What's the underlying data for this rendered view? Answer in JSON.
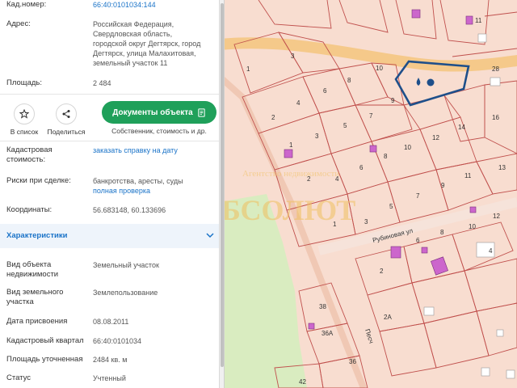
{
  "info": {
    "cad_number_label": "Кад.номер:",
    "cad_number_value": "66:40:0101034:144",
    "address_label": "Адрес:",
    "address_lines": [
      "Российская Федерация,",
      "Свердловская область,",
      "городской округ Дегтярск, город",
      "Дегтярск, улица Малахитовая,",
      "земельный участок 11"
    ],
    "area_label": "Площадь:",
    "area_value": "2 484"
  },
  "actions": {
    "favorites_label": "В список",
    "share_label": "Поделиться",
    "docs_button_label": "Документы объекта",
    "docs_sub_label": "Собственник, стоимость и др."
  },
  "details": {
    "cad_value_label_1": "Кадастровая",
    "cad_value_label_2": "стоимость:",
    "cad_value_link": "заказать справку на дату",
    "risks_label": "Риски при сделке:",
    "risks_value": "банкротства, аресты, суды",
    "risks_link": "полная проверка",
    "coords_label": "Координаты:",
    "coords_value": "56.683148, 60.133696"
  },
  "characteristics": {
    "section_title": "Характеристики",
    "rows": [
      {
        "label_1": "Вид объекта",
        "label_2": "недвижимости",
        "value": "Земельный участок"
      },
      {
        "label_1": "Вид земельного",
        "label_2": "участка",
        "value": "Землепользование"
      },
      {
        "label_1": "Дата присвоения",
        "label_2": "",
        "value": "08.08.2011"
      },
      {
        "label_1": "Кадастровый квартал",
        "label_2": "",
        "value": "66:40:0101034"
      },
      {
        "label_1": "Площадь уточненная",
        "label_2": "",
        "value": "2484 кв. м"
      },
      {
        "label_1": "Статус",
        "label_2": "",
        "value": "Учтенный"
      }
    ]
  },
  "map": {
    "street_name": "Рубиновая ул",
    "street_name_2": "Песч",
    "watermark": "АБСОЛЮТ",
    "watermark_top": "Агентство недвижимости",
    "plot_numbers": [
      "1",
      "3",
      "8",
      "6",
      "4",
      "2",
      "10",
      "9",
      "7",
      "5",
      "3",
      "1",
      "14",
      "12",
      "10",
      "8",
      "6",
      "4",
      "2",
      "11",
      "9",
      "7",
      "5",
      "3",
      "1",
      "13",
      "16",
      "28",
      "12",
      "10",
      "8",
      "6",
      "4",
      "2",
      "38",
      "36А",
      "36",
      "42",
      "2А",
      "11"
    ],
    "colors": {
      "accent": "#1fa05a",
      "link": "#1a73c8",
      "plot_line": "#c0504d",
      "highlight": "#1e4f8a",
      "road": "#f5c98a",
      "forest": "#d9ecc0",
      "building": "#cc66cc"
    }
  }
}
